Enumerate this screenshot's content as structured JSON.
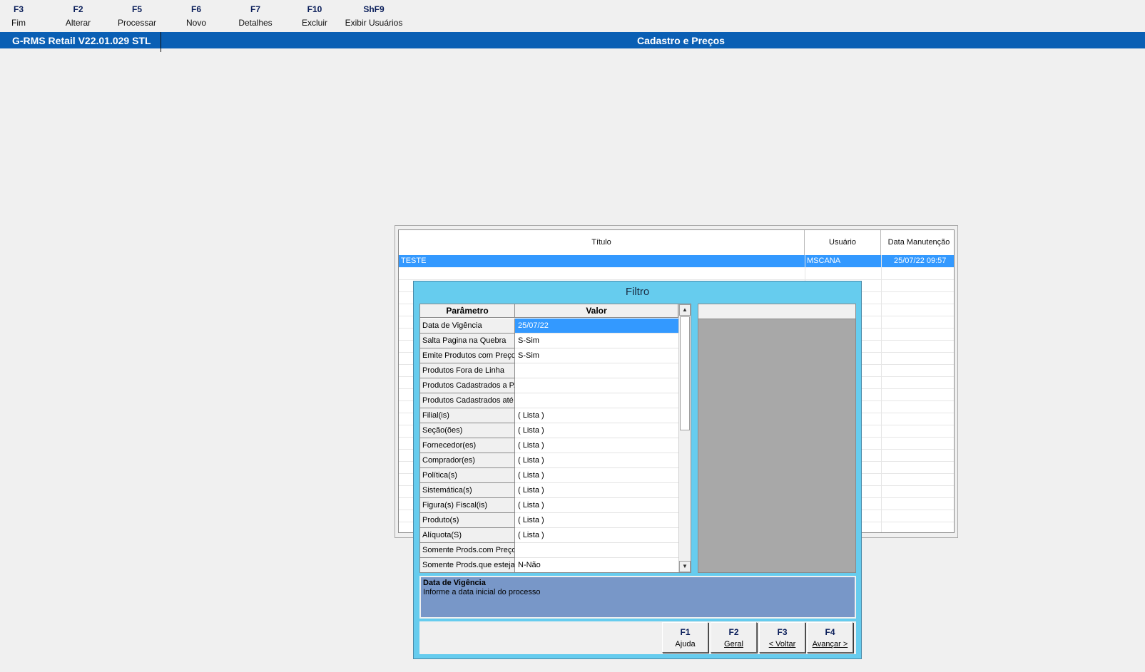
{
  "toolbar": {
    "keys": [
      {
        "key": "F3",
        "label": "Fim"
      },
      {
        "key": "F2",
        "label": "Alterar"
      },
      {
        "key": "F5",
        "label": "Processar"
      },
      {
        "key": "F6",
        "label": "Novo"
      },
      {
        "key": "F7",
        "label": "Detalhes"
      },
      {
        "key": "F10",
        "label": "Excluir"
      },
      {
        "key": "ShF9",
        "label": "Exibir Usuários"
      }
    ]
  },
  "titlebar": {
    "app": "G-RMS Retail V22.01.029 STL",
    "module": "Cadastro e Preços"
  },
  "grid": {
    "headers": [
      "Título",
      "Usuário",
      "Data Manutenção"
    ],
    "rows": [
      {
        "titulo": "TESTE",
        "usuario": "MSCANA",
        "data": "25/07/22 09:57"
      }
    ]
  },
  "filter": {
    "title": "Filtro",
    "headers": {
      "param": "Parâmetro",
      "valor": "Valor"
    },
    "params": [
      {
        "param": "Data de Vigência",
        "valor": "25/07/22"
      },
      {
        "param": "Salta Pagina na Quebra",
        "valor": "S-Sim"
      },
      {
        "param": "Emite Produtos com Preço",
        "valor": "S-Sim"
      },
      {
        "param": "Produtos Fora de Linha",
        "valor": ""
      },
      {
        "param": "Produtos Cadastrados a P.",
        "valor": ""
      },
      {
        "param": "Produtos Cadastrados até",
        "valor": ""
      },
      {
        "param": "Filial(is)",
        "valor": "( Lista )"
      },
      {
        "param": "Seção(ões)",
        "valor": "( Lista )"
      },
      {
        "param": "Fornecedor(es)",
        "valor": "( Lista )"
      },
      {
        "param": "Comprador(es)",
        "valor": "( Lista )"
      },
      {
        "param": "Política(s)",
        "valor": "( Lista )"
      },
      {
        "param": "Sistemática(s)",
        "valor": "( Lista )"
      },
      {
        "param": "Figura(s) Fiscal(is)",
        "valor": "( Lista )"
      },
      {
        "param": "Produto(s)",
        "valor": "( Lista )"
      },
      {
        "param": "Alíquota(S)",
        "valor": "( Lista )"
      },
      {
        "param": "Somente Prods.com Preço",
        "valor": ""
      },
      {
        "param": "Somente Prods.que esteja",
        "valor": "N-Não"
      }
    ],
    "help": {
      "title": "Data de Vigência",
      "text": "Informe a data inicial do processo"
    },
    "buttons": [
      {
        "key": "F1",
        "label": "Ajuda"
      },
      {
        "key": "F2",
        "label": "Geral"
      },
      {
        "key": "F3",
        "label": "< Voltar"
      },
      {
        "key": "F4",
        "label": "Avançar >"
      }
    ]
  }
}
